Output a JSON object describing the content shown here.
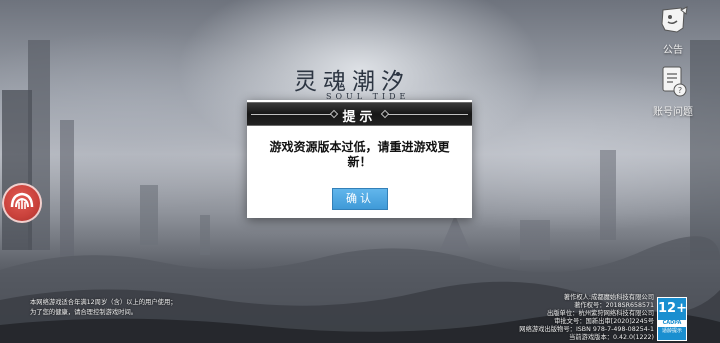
{
  "menu": {
    "notice_label": "公告",
    "account_label": "账号问题"
  },
  "logo": {
    "title_cn": "灵魂潮汐",
    "title_en": "SOUL TIDE"
  },
  "dialog": {
    "title": "提示",
    "message": "游戏资源版本过低，请重进游戏更新！",
    "confirm_label": "确认"
  },
  "footer": {
    "health_lines": [
      "本网络游戏适合年满12周岁（含）以上的用户使用；",
      "为了您的健康，请合理控制游戏时间。"
    ],
    "copyright_lines": [
      "著作权人:成都魔始科技有限公司",
      "著作权号：2018SR658571",
      "出版单位：杭州紫狩网络科技有限公司",
      "审批文号：国新出审[2020]2245号",
      "网络游戏出版物号：ISBN 978-7-498-08254-1",
      "当前游戏版本：0.42.0(1222)"
    ]
  },
  "age_rating": {
    "label": "12+",
    "org": "CADPA",
    "tip": "适龄提示"
  },
  "colors": {
    "dialog_header": "#161616",
    "confirm_button": "#4aa6e0",
    "float_button": "#c9413b",
    "age_badge": "#1a8fd0"
  }
}
